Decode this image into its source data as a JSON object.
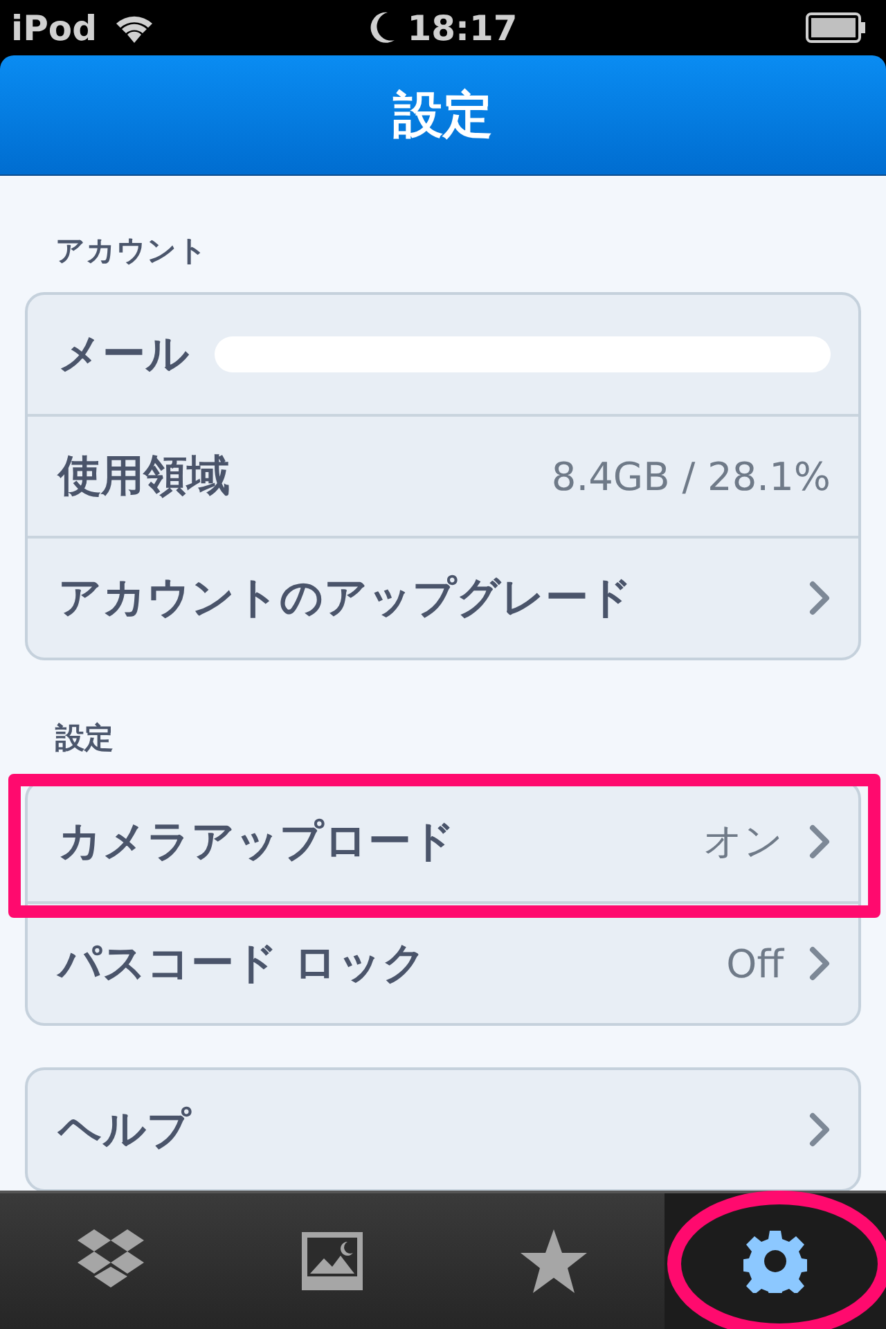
{
  "status_bar": {
    "carrier": "iPod",
    "time": "18:17"
  },
  "nav_bar": {
    "title": "設定"
  },
  "sections": [
    {
      "header": "アカウント",
      "rows": [
        {
          "label": "メール",
          "redacted": true,
          "chevron": false,
          "highlighted": false
        },
        {
          "label": "使用領域",
          "value": "8.4GB / 28.1%",
          "chevron": false,
          "highlighted": false
        },
        {
          "label": "アカウントのアップグレード",
          "chevron": true,
          "highlighted": false
        }
      ]
    },
    {
      "header": "設定",
      "rows": [
        {
          "label": "カメラアップロード",
          "value": "オン",
          "chevron": true,
          "highlighted": true
        },
        {
          "label": "パスコード ロック",
          "value": "Off",
          "chevron": true,
          "highlighted": false
        }
      ]
    },
    {
      "rows": [
        {
          "label": "ヘルプ",
          "chevron": true,
          "highlighted": false
        }
      ]
    }
  ],
  "tabs": [
    {
      "kind": "dropbox",
      "selected": false,
      "highlighted": false
    },
    {
      "kind": "photos",
      "selected": false,
      "highlighted": false
    },
    {
      "kind": "favorites",
      "selected": false,
      "highlighted": false
    },
    {
      "kind": "settings",
      "selected": true,
      "highlighted": true
    }
  ]
}
